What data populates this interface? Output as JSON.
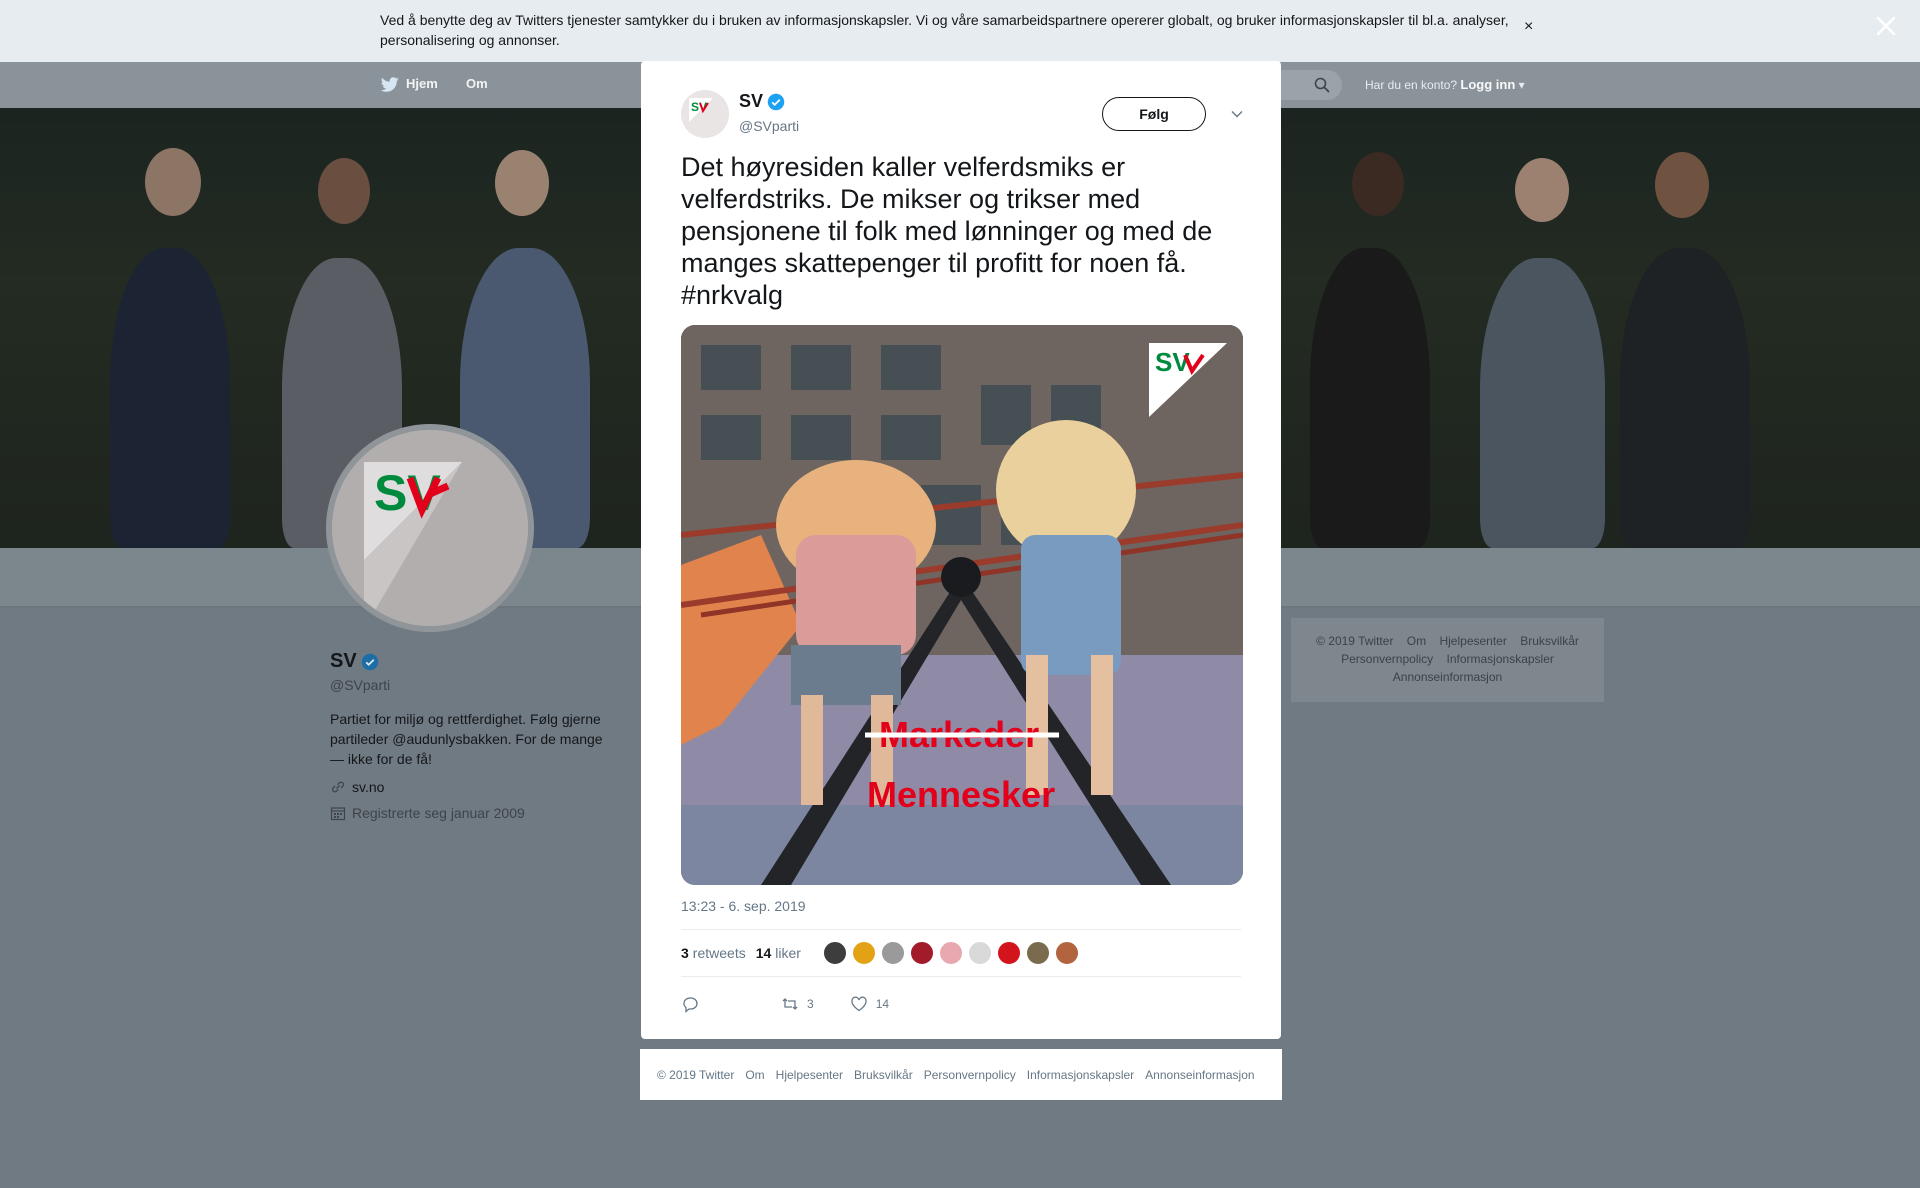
{
  "cookie_banner": {
    "message": "Ved å benytte deg av Twitters tjenester samtykker du i bruken av informasjonskapsler. Vi og våre samarbeidspartnere opererer globalt, og bruker informasjonskapsler til bl.a. analyser, personalisering og annonser.",
    "close_glyph": "×"
  },
  "topnav": {
    "home_label": "Hjem",
    "about_label": "Om",
    "account_prompt": "Har du en konto?",
    "login_label": "Logg inn"
  },
  "profile": {
    "name": "SV",
    "handle": "@SVparti",
    "bio": "Partiet for miljø og rettferdighet. Følg gjerne partileder @audunlysbakken. For de mange — ikke for de få!",
    "website": "sv.no",
    "joined": "Registrerte seg januar 2009"
  },
  "side_footer": {
    "links": [
      "© 2019 Twitter",
      "Om",
      "Hjelpesenter",
      "Bruksvilkår",
      "Personvernpolicy",
      "Informasjonskapsler",
      "Annonseinformasjon"
    ]
  },
  "tweet": {
    "author_name": "SV",
    "author_handle": "@SVparti",
    "follow_label": "Følg",
    "text": "Det høyresiden kaller velferdsmiks er velferdstriks. De mikser og trikser med pensjonene til folk med lønninger og med de manges skattepenger til profitt for noen få. #nrkvalg",
    "image_text_struck": "Markeder",
    "image_text_main": "Mennesker",
    "logo_text": "SV",
    "timestamp": "13:23 - 6. sep. 2019",
    "retweet_count": "3",
    "retweet_label": "retweets",
    "like_count": "14",
    "like_label": "liker",
    "action_retweets": "3",
    "action_likes": "14"
  },
  "modal_footer": {
    "links": [
      "© 2019 Twitter",
      "Om",
      "Hjelpesenter",
      "Bruksvilkår",
      "Personvernpolicy",
      "Informasjonskapsler",
      "Annonseinformasjon"
    ]
  },
  "colors": {
    "brand_red": "#e2001a",
    "brand_green": "#008a3e",
    "verified_blue": "#1da1f2",
    "twitter_blue": "#1da1f2"
  }
}
